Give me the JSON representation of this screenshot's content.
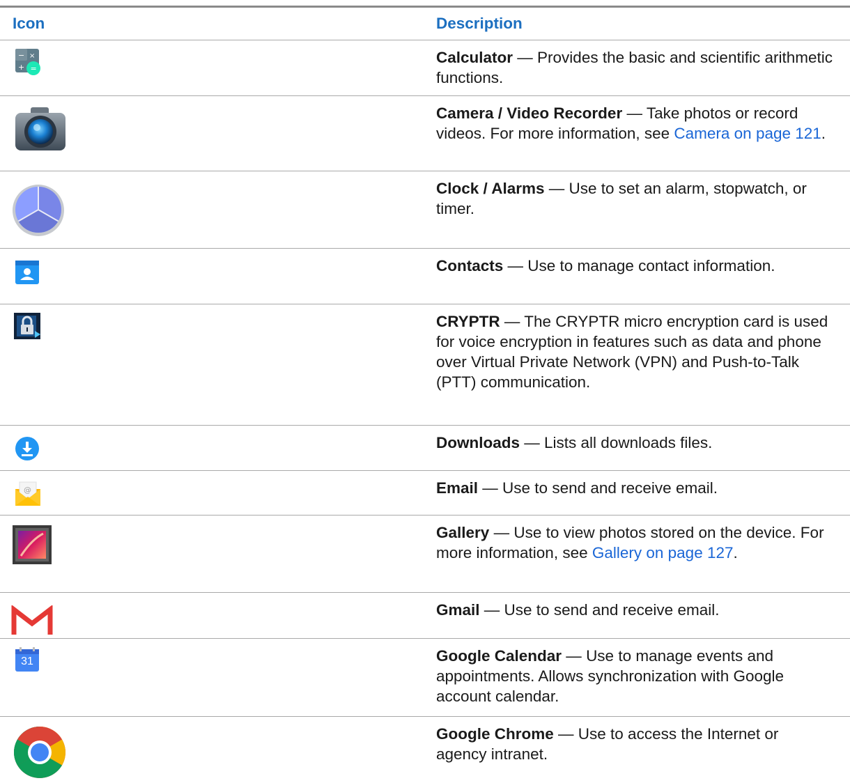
{
  "table": {
    "headers": {
      "icon": "Icon",
      "description": "Description"
    },
    "rows": [
      {
        "icon": "calculator-icon",
        "name": "Calculator",
        "sep": " — ",
        "text": "Provides the basic and scientific arithmetic functions."
      },
      {
        "icon": "camera-icon",
        "name": "Camera / Video Recorder",
        "sep": " — ",
        "text": "Take photos or record videos. For more information, see ",
        "link": "Camera on page 121",
        "after": "."
      },
      {
        "icon": "clock-icon",
        "name": "Clock / Alarms",
        "sep": " — ",
        "text": "Use to set an alarm, stopwatch, or timer."
      },
      {
        "icon": "contacts-icon",
        "name": "Contacts",
        "sep": " — ",
        "text": "Use to manage contact information."
      },
      {
        "icon": "cryptr-lock-icon",
        "name": "CRYPTR",
        "sep": " — ",
        "text": "The CRYPTR micro encryption card is used for voice encryption in features such as data and phone over Virtual Private Network (VPN) and Push-to-Talk (PTT) communication."
      },
      {
        "icon": "downloads-icon",
        "name": "Downloads",
        "sep": " — ",
        "text": "Lists all downloads files."
      },
      {
        "icon": "email-icon",
        "name": "Email",
        "sep": " — ",
        "text": "Use to send and receive email."
      },
      {
        "icon": "gallery-icon",
        "name": "Gallery",
        "sep": " — ",
        "text": "Use to view photos stored on the device. For more information, see ",
        "link": "Gallery on page 127",
        "after": "."
      },
      {
        "icon": "gmail-icon",
        "name": "Gmail",
        "sep": " — ",
        "text": "Use to send and receive email."
      },
      {
        "icon": "google-calendar-icon",
        "name": "Google Calendar",
        "sep": " — ",
        "text": "Use to manage events and appointments. Allows synchronization with Google account calendar.",
        "icon_text": "31"
      },
      {
        "icon": "google-chrome-icon",
        "name": "Google Chrome",
        "sep": " — ",
        "text": "Use to access the Internet or agency intranet."
      }
    ]
  }
}
